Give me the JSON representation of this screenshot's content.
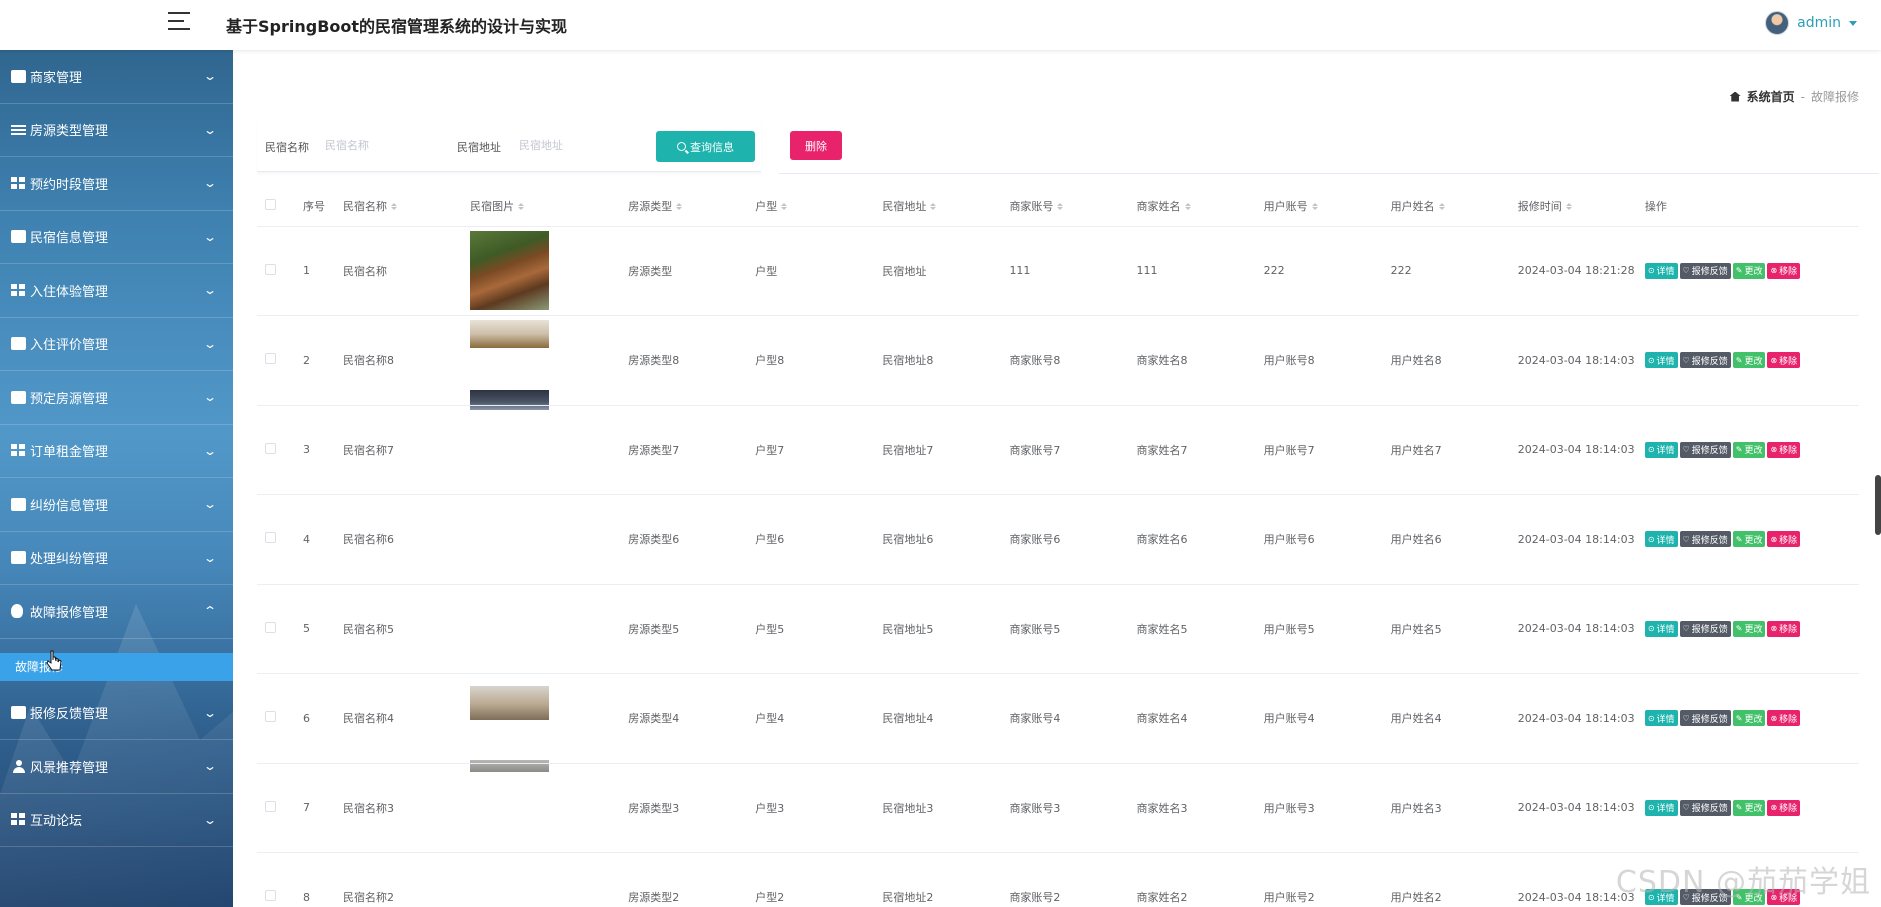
{
  "header": {
    "title": "基于SpringBoot的民宿管理系统的设计与实现",
    "user": "admin"
  },
  "sidebar": {
    "items": [
      {
        "label": "商家管理",
        "icon": "chat-icon",
        "chevron": "⌄"
      },
      {
        "label": "房源类型管理",
        "icon": "list-icon",
        "chevron": "⌄"
      },
      {
        "label": "预约时段管理",
        "icon": "grid-icon",
        "chevron": "⌄"
      },
      {
        "label": "民宿信息管理",
        "icon": "clipboard-icon",
        "chevron": "⌄"
      },
      {
        "label": "入住体验管理",
        "icon": "grid-icon",
        "chevron": "⌄"
      },
      {
        "label": "入住评价管理",
        "icon": "chart-icon",
        "chevron": "⌄"
      },
      {
        "label": "预定房源管理",
        "icon": "clipboard-icon",
        "chevron": "⌄"
      },
      {
        "label": "订单租金管理",
        "icon": "grid-icon",
        "chevron": "⌄"
      },
      {
        "label": "纠纷信息管理",
        "icon": "chat-icon",
        "chevron": "⌄"
      },
      {
        "label": "处理纠纷管理",
        "icon": "book-icon",
        "chevron": "⌄"
      },
      {
        "label": "故障报修管理",
        "icon": "bulb-icon",
        "chevron": "⌃"
      },
      {
        "label": "报修反馈管理",
        "icon": "clipboard-icon",
        "chevron": "⌄"
      },
      {
        "label": "风景推荐管理",
        "icon": "person-icon",
        "chevron": "⌄"
      },
      {
        "label": "互动论坛",
        "icon": "grid-icon",
        "chevron": "⌄"
      }
    ],
    "active_submenu": "故障报修"
  },
  "breadcrumb": {
    "home": "系统首页",
    "separator": "-",
    "current": "故障报修"
  },
  "search": {
    "name_label": "民宿名称",
    "name_placeholder": "民宿名称",
    "address_label": "民宿地址",
    "address_placeholder": "民宿地址",
    "button": "查询信息"
  },
  "actions": {
    "delete": "删除"
  },
  "table": {
    "headers": [
      "序号",
      "民宿名称",
      "民宿图片",
      "房源类型",
      "户型",
      "民宿地址",
      "商家账号",
      "商家姓名",
      "用户账号",
      "用户姓名",
      "报修时间",
      "操作"
    ],
    "row_actions": [
      "详情",
      "报修反馈",
      "更改",
      "移除"
    ],
    "rows": [
      {
        "no": "1",
        "name": "民宿名称",
        "type": "房源类型",
        "layout": "户型",
        "address": "民宿地址",
        "merchant_account": "111",
        "merchant_name": "111",
        "user_account": "222",
        "user_name": "222",
        "time": "2024-03-04 18:21:28"
      },
      {
        "no": "2",
        "name": "民宿名称8",
        "type": "房源类型8",
        "layout": "户型8",
        "address": "民宿地址8",
        "merchant_account": "商家账号8",
        "merchant_name": "商家姓名8",
        "user_account": "用户账号8",
        "user_name": "用户姓名8",
        "time": "2024-03-04 18:14:03"
      },
      {
        "no": "3",
        "name": "民宿名称7",
        "type": "房源类型7",
        "layout": "户型7",
        "address": "民宿地址7",
        "merchant_account": "商家账号7",
        "merchant_name": "商家姓名7",
        "user_account": "用户账号7",
        "user_name": "用户姓名7",
        "time": "2024-03-04 18:14:03"
      },
      {
        "no": "4",
        "name": "民宿名称6",
        "type": "房源类型6",
        "layout": "户型6",
        "address": "民宿地址6",
        "merchant_account": "商家账号6",
        "merchant_name": "商家姓名6",
        "user_account": "用户账号6",
        "user_name": "用户姓名6",
        "time": "2024-03-04 18:14:03"
      },
      {
        "no": "5",
        "name": "民宿名称5",
        "type": "房源类型5",
        "layout": "户型5",
        "address": "民宿地址5",
        "merchant_account": "商家账号5",
        "merchant_name": "商家姓名5",
        "user_account": "用户账号5",
        "user_name": "用户姓名5",
        "time": "2024-03-04 18:14:03"
      },
      {
        "no": "6",
        "name": "民宿名称4",
        "type": "房源类型4",
        "layout": "户型4",
        "address": "民宿地址4",
        "merchant_account": "商家账号4",
        "merchant_name": "商家姓名4",
        "user_account": "用户账号4",
        "user_name": "用户姓名4",
        "time": "2024-03-04 18:14:03"
      },
      {
        "no": "7",
        "name": "民宿名称3",
        "type": "房源类型3",
        "layout": "户型3",
        "address": "民宿地址3",
        "merchant_account": "商家账号3",
        "merchant_name": "商家姓名3",
        "user_account": "用户账号3",
        "user_name": "用户姓名3",
        "time": "2024-03-04 18:14:03"
      },
      {
        "no": "8",
        "name": "民宿名称2",
        "type": "房源类型2",
        "layout": "户型2",
        "address": "民宿地址2",
        "merchant_account": "商家账号2",
        "merchant_name": "商家姓名2",
        "user_account": "用户账号2",
        "user_name": "用户姓名2",
        "time": "2024-03-04 18:14:03"
      }
    ]
  },
  "watermark": "CSDN @茄茄学姐",
  "colors": {
    "accent": "#1eb4ad",
    "danger": "#e8236c",
    "success": "#43c16a",
    "dark": "#555b66",
    "sidebar_active": "#3aa2e8"
  }
}
